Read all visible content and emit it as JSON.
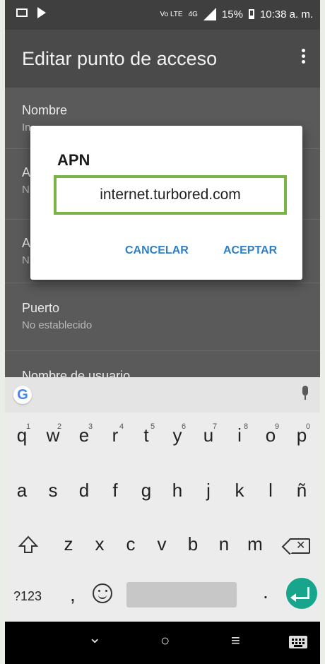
{
  "status": {
    "network": "Vo LTE",
    "signal": "4G",
    "battery": "15%",
    "time": "10:38 a. m."
  },
  "appbar": {
    "title": "Editar punto de acceso"
  },
  "settings": [
    {
      "label": "Nombre",
      "value": "In"
    },
    {
      "label": "A",
      "value": "N"
    },
    {
      "label": "A",
      "value": "N"
    },
    {
      "label": "Puerto",
      "value": "No establecido"
    },
    {
      "label": "Nombre de usuario",
      "value": ""
    }
  ],
  "dialog": {
    "title": "APN",
    "field_value": "internet.turbored.com",
    "cancel_label": "CANCELAR",
    "accept_label": "ACEPTAR"
  },
  "keyboard": {
    "row1": [
      {
        "key": "q",
        "num": "1"
      },
      {
        "key": "w",
        "num": "2"
      },
      {
        "key": "e",
        "num": "3"
      },
      {
        "key": "r",
        "num": "4"
      },
      {
        "key": "t",
        "num": "5"
      },
      {
        "key": "y",
        "num": "6"
      },
      {
        "key": "u",
        "num": "7"
      },
      {
        "key": "i",
        "num": "8"
      },
      {
        "key": "o",
        "num": "9"
      },
      {
        "key": "p",
        "num": "0"
      }
    ],
    "row2": [
      "a",
      "s",
      "d",
      "f",
      "g",
      "h",
      "j",
      "k",
      "l",
      "ñ"
    ],
    "row3": [
      "z",
      "x",
      "c",
      "v",
      "b",
      "n",
      "m"
    ],
    "key_123": "?123",
    "comma": ",",
    "period": ".",
    "google_logo": "G"
  },
  "navbar": {
    "back": "⌄",
    "home": "○",
    "recent": "≡"
  }
}
